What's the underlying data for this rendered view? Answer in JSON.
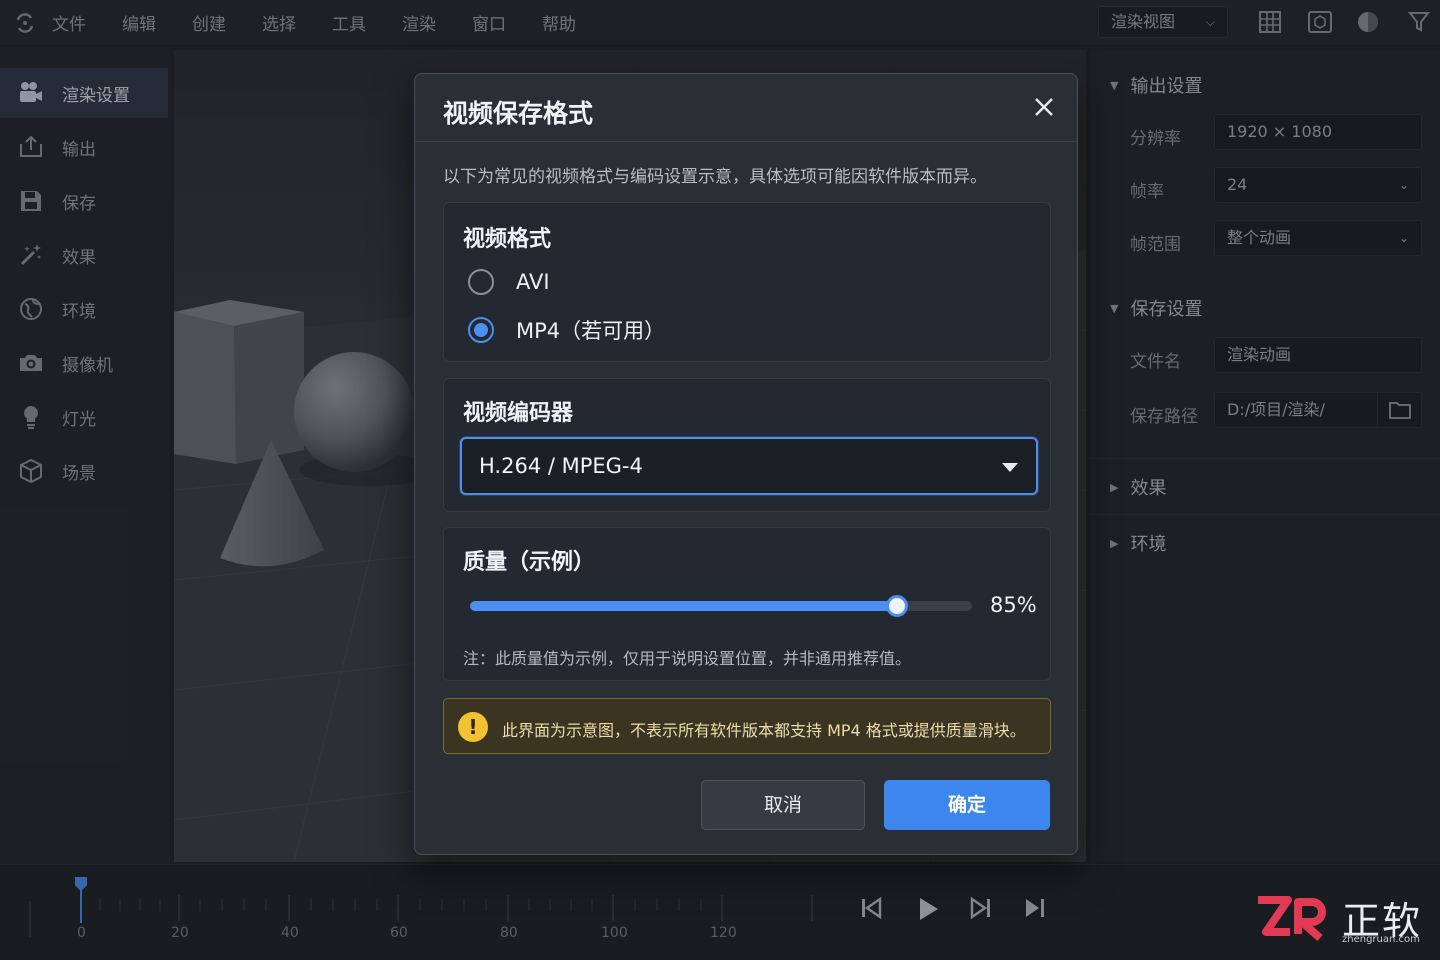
{
  "menu": {
    "items": [
      "文件",
      "编辑",
      "创建",
      "选择",
      "工具",
      "渲染",
      "窗口",
      "帮助"
    ],
    "view_select": "渲染视图"
  },
  "sidebar": {
    "items": [
      {
        "label": "渲染设置",
        "icon": "camera-film-icon",
        "active": true
      },
      {
        "label": "输出",
        "icon": "export-icon"
      },
      {
        "label": "保存",
        "icon": "save-icon"
      },
      {
        "label": "效果",
        "icon": "magic-wand-icon"
      },
      {
        "label": "环境",
        "icon": "globe-icon"
      },
      {
        "label": "摄像机",
        "icon": "camera-icon"
      },
      {
        "label": "灯光",
        "icon": "lightbulb-icon"
      },
      {
        "label": "场景",
        "icon": "cube-icon"
      }
    ]
  },
  "right_panel": {
    "output": {
      "title": "输出设置",
      "resolution_label": "分辨率",
      "resolution_value": "1920 × 1080",
      "framerate_label": "帧率",
      "framerate_value": "24",
      "range_label": "帧范围",
      "range_value": "整个动画"
    },
    "save": {
      "title": "保存设置",
      "filename_label": "文件名",
      "filename_value": "渲染动画",
      "path_label": "保存路径",
      "path_value": "D:/项目/渲染/"
    },
    "effects_title": "效果",
    "environment_title": "环境"
  },
  "dialog": {
    "title": "视频保存格式",
    "description": "以下为常见的视频格式与编码设置示意，具体选项可能因软件版本而异。",
    "format_group": {
      "title": "视频格式",
      "options": [
        {
          "label": "AVI",
          "selected": false
        },
        {
          "label": "MP4（若可用）",
          "selected": true
        }
      ]
    },
    "codec_group": {
      "title": "视频编码器",
      "selected": "H.264 / MPEG-4"
    },
    "quality_group": {
      "title": "质量（示例）",
      "value": 85,
      "value_label": "85%",
      "note": "注：此质量值为示例，仅用于说明设置位置，并非通用推荐值。"
    },
    "warning": "此界面为示意图，不表示所有软件版本都支持 MP4 格式或提供质量滑块。",
    "cancel_label": "取消",
    "ok_label": "确定"
  },
  "timeline": {
    "ticks": [
      "0",
      "20",
      "40",
      "60",
      "80",
      "100",
      "120"
    ],
    "playhead_frame": 0
  },
  "watermark": {
    "logo": "ZR",
    "name": "正软",
    "url": "zhengruan.com"
  },
  "colors": {
    "accent": "#4b8ff0",
    "warning": "#f2c232",
    "panel_bg": "#24282e",
    "dialog_bg": "#2a2e35"
  }
}
